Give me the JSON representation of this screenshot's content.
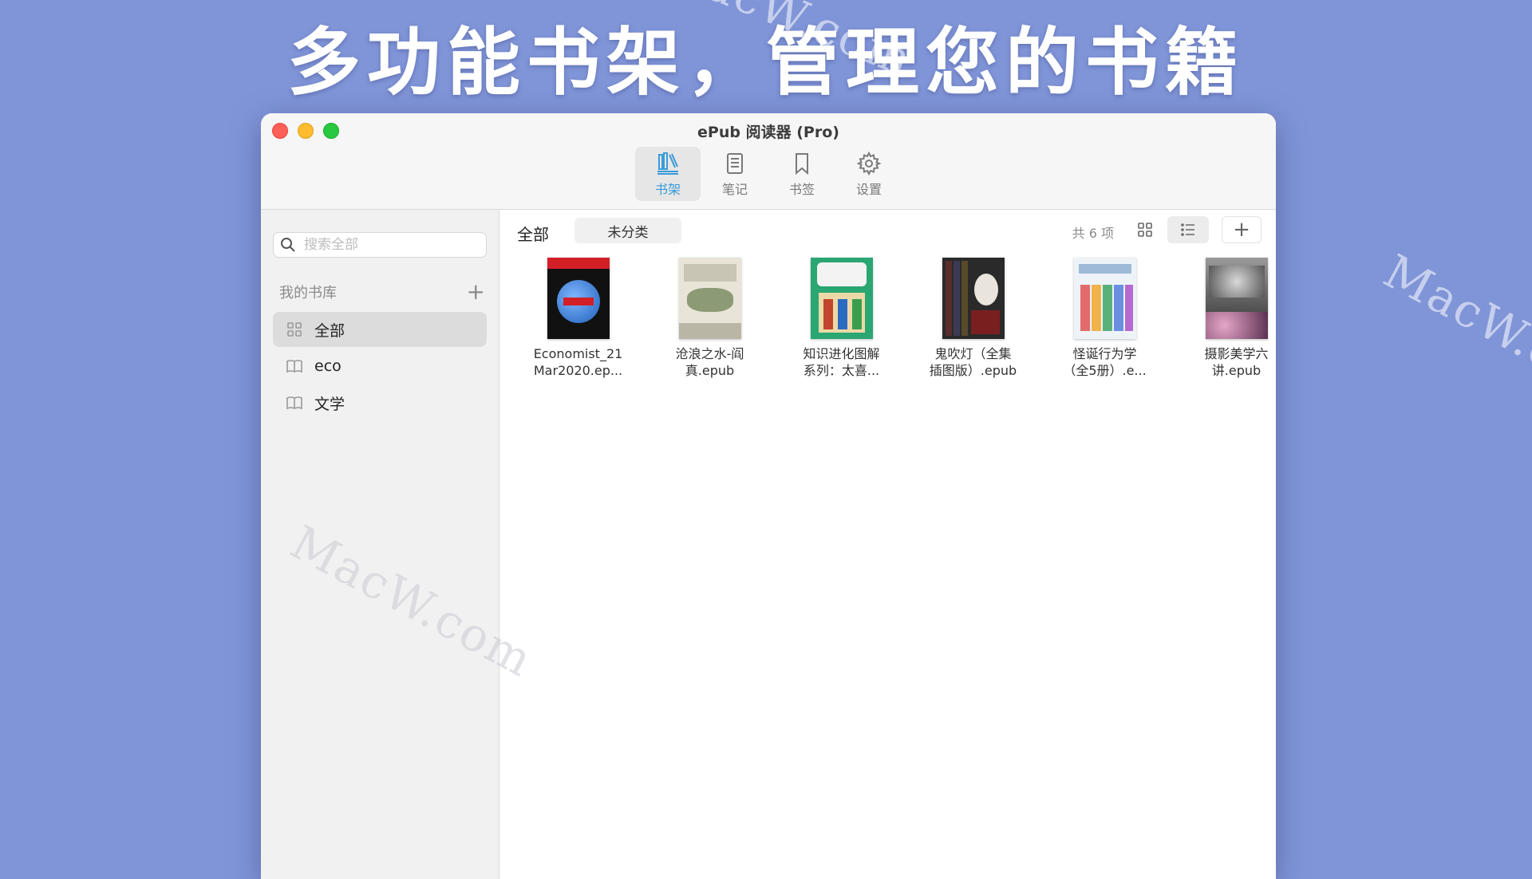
{
  "headline": "多功能书架，管理您的书籍",
  "watermark": "MacW.com",
  "window": {
    "title": "ePub 阅读器 (Pro)",
    "toolbar": [
      {
        "label": "书架",
        "icon": "bookshelf-icon",
        "active": true
      },
      {
        "label": "笔记",
        "icon": "notes-icon",
        "active": false
      },
      {
        "label": "书签",
        "icon": "bookmark-icon",
        "active": false
      },
      {
        "label": "设置",
        "icon": "gear-icon",
        "active": false
      }
    ]
  },
  "sidebar": {
    "search_placeholder": "搜索全部",
    "library_header": "我的书库",
    "items": [
      {
        "label": "全部",
        "icon": "grid-icon",
        "selected": true
      },
      {
        "label": "eco",
        "icon": "book-icon",
        "selected": false
      },
      {
        "label": "文学",
        "icon": "book-icon",
        "selected": false
      }
    ]
  },
  "main": {
    "filter_all": "全部",
    "filter_uncategorized": "未分类",
    "count": "共 6 项",
    "books": [
      {
        "title_line1": "Economist_21",
        "title_line2": "Mar2020.ep..."
      },
      {
        "title_line1": "沧浪之水-阎",
        "title_line2": "真.epub"
      },
      {
        "title_line1": "知识进化图解",
        "title_line2": "系列：太喜..."
      },
      {
        "title_line1": "鬼吹灯（全集",
        "title_line2": "插图版）.epub"
      },
      {
        "title_line1": "怪诞行为学",
        "title_line2": "（全5册）.e..."
      },
      {
        "title_line1": "摄影美学六",
        "title_line2": "讲.epub"
      }
    ]
  },
  "colors": {
    "background": "#8095d8",
    "accent": "#3a9bd9",
    "close": "#ff5f57",
    "minimize": "#febc2e",
    "maximize": "#28c840"
  }
}
